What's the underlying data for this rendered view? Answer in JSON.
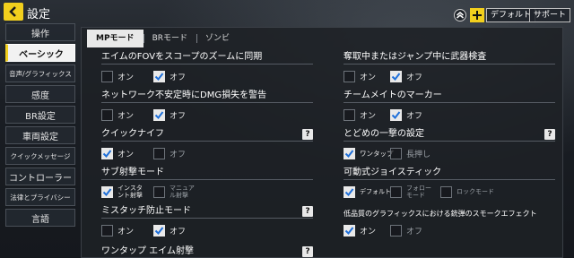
{
  "header": {
    "title": "設定",
    "default_label": "デフォルト",
    "support_label": "サポート",
    "accent": "#f2cf1d"
  },
  "sidebar": {
    "items": [
      {
        "label": "操作"
      },
      {
        "label": "ベーシック",
        "active": true
      },
      {
        "label": "音声/グラフィックス"
      },
      {
        "label": "感度"
      },
      {
        "label": "BR設定"
      },
      {
        "label": "車両設定"
      },
      {
        "label": "クイックメッセージ"
      },
      {
        "label": "コントローラー"
      },
      {
        "label": "法律とプライバシー"
      },
      {
        "label": "言語"
      }
    ]
  },
  "tabs": [
    {
      "label": "MPモード",
      "active": true
    },
    {
      "label": "BRモード"
    },
    {
      "label": "ゾンビ"
    }
  ],
  "settings_left": [
    {
      "title": "エイムのFOVをスコープのズームに同期",
      "options": [
        {
          "label": "オン",
          "checked": false
        },
        {
          "label": "オフ",
          "checked": true
        }
      ]
    },
    {
      "title": "ネットワーク不安定時にDMG損失を警告",
      "options": [
        {
          "label": "オン",
          "checked": false
        },
        {
          "label": "オフ",
          "checked": true
        }
      ]
    },
    {
      "title": "クイックナイフ",
      "help": "?",
      "options": [
        {
          "label": "オン",
          "checked": true
        },
        {
          "label": "オフ",
          "checked": false
        }
      ]
    },
    {
      "title": "サブ射撃モード",
      "options": [
        {
          "label": "インスタント射撃",
          "checked": true
        },
        {
          "label": "マニュアル射撃",
          "checked": false
        }
      ]
    },
    {
      "title": "ミスタッチ防止モード",
      "help": "?",
      "options": [
        {
          "label": "オン",
          "checked": false
        },
        {
          "label": "オフ",
          "checked": true
        }
      ]
    },
    {
      "title": "ワンタップ エイム射撃",
      "help": "?",
      "options": []
    }
  ],
  "settings_right": [
    {
      "title": "奪取中またはジャンプ中に武器検査",
      "options": [
        {
          "label": "オン",
          "checked": false
        },
        {
          "label": "オフ",
          "checked": true
        }
      ]
    },
    {
      "title": "チームメイトのマーカー",
      "options": [
        {
          "label": "オン",
          "checked": false
        },
        {
          "label": "オフ",
          "checked": true
        }
      ]
    },
    {
      "title": "とどめの一撃の設定",
      "help": "?",
      "options": [
        {
          "label": "ワンタップ",
          "checked": true
        },
        {
          "label": "長押し",
          "checked": false
        }
      ]
    },
    {
      "title": "可動式ジョイスティック",
      "options": [
        {
          "label": "デフォルト",
          "checked": true
        },
        {
          "label": "フォローモード",
          "checked": false
        },
        {
          "label": "ロックモード",
          "checked": false
        }
      ]
    },
    {
      "title": "低品質のグラフィックスにおける銃弾のスモークエフェクト",
      "options": [
        {
          "label": "オン",
          "checked": true
        },
        {
          "label": "オフ",
          "checked": false
        }
      ]
    }
  ]
}
